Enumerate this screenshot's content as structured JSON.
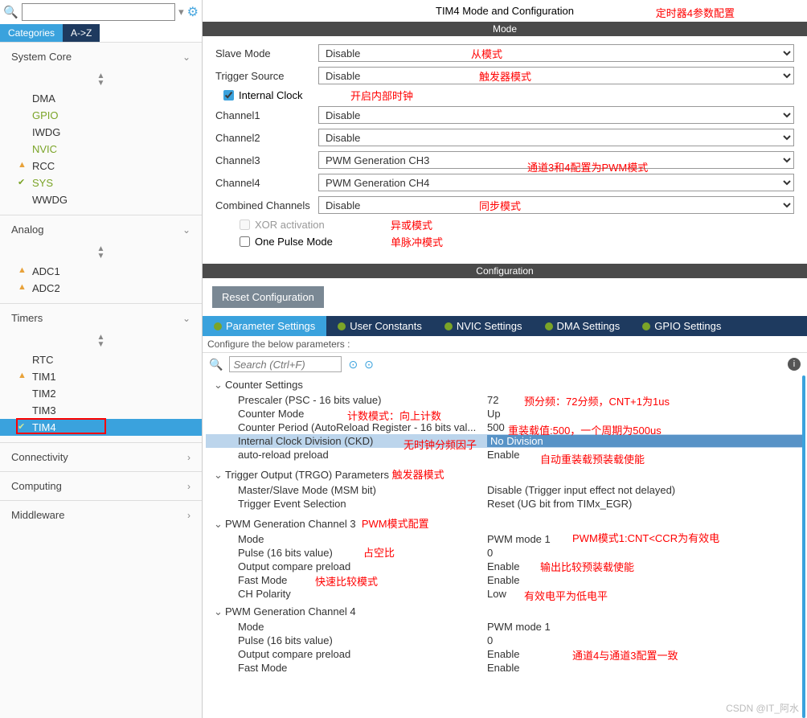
{
  "header": {
    "title": "TIM4 Mode and Configuration",
    "ann_title": "定时器4参数配置"
  },
  "search": {
    "placeholder": ""
  },
  "sb_tabs": {
    "cat": "Categories",
    "az": "A->Z"
  },
  "cats": {
    "system": {
      "label": "System Core",
      "items": [
        "DMA",
        "GPIO",
        "IWDG",
        "NVIC",
        "RCC",
        "SYS",
        "WWDG"
      ]
    },
    "analog": {
      "label": "Analog",
      "items": [
        "ADC1",
        "ADC2"
      ]
    },
    "timers": {
      "label": "Timers",
      "items": [
        "RTC",
        "TIM1",
        "TIM2",
        "TIM3",
        "TIM4"
      ]
    },
    "conn": {
      "label": "Connectivity"
    },
    "comp": {
      "label": "Computing"
    },
    "mw": {
      "label": "Middleware"
    }
  },
  "mode": {
    "hdr": "Mode",
    "slave": {
      "l": "Slave Mode",
      "v": "Disable",
      "a": "从模式"
    },
    "trig": {
      "l": "Trigger Source",
      "v": "Disable",
      "a": "触发器模式"
    },
    "clk": {
      "l": "Internal Clock",
      "a": "开启内部时钟"
    },
    "ch1": {
      "l": "Channel1",
      "v": "Disable"
    },
    "ch2": {
      "l": "Channel2",
      "v": "Disable"
    },
    "ch3": {
      "l": "Channel3",
      "v": "PWM Generation CH3"
    },
    "ch4": {
      "l": "Channel4",
      "v": "PWM Generation CH4"
    },
    "ch_ann": "通道3和4配置为PWM模式",
    "comb": {
      "l": "Combined Channels",
      "v": "Disable",
      "a": "同步模式"
    },
    "xor": {
      "l": "XOR activation",
      "a": "异或模式"
    },
    "pulse": {
      "l": "One Pulse Mode",
      "a": "单脉冲模式"
    }
  },
  "cfg": {
    "hdr": "Configuration",
    "reset": "Reset Configuration",
    "tabs": [
      "Parameter Settings",
      "User Constants",
      "NVIC Settings",
      "DMA Settings",
      "GPIO Settings"
    ],
    "sub": "Configure the below parameters :",
    "search_ph": "Search (Ctrl+F)"
  },
  "params": {
    "g1": {
      "h": "Counter Settings",
      "r1": {
        "l": "Prescaler (PSC - 16 bits value)",
        "v": "72",
        "a": "预分频：72分频，CNT+1为1us"
      },
      "r2": {
        "l": "Counter Mode",
        "v": "Up",
        "a": "计数模式：向上计数"
      },
      "r3": {
        "l": "Counter Period (AutoReload Register - 16 bits val...",
        "v": "500",
        "a": "重装载值:500，一个周期为500us"
      },
      "r4": {
        "l": "Internal Clock Division (CKD)",
        "v": "No Division",
        "a": "无时钟分频因子"
      },
      "r5": {
        "l": "auto-reload preload",
        "v": "Enable",
        "a": "自动重装载预装载使能"
      }
    },
    "g2": {
      "h": "Trigger Output (TRGO) Parameters",
      "a": "触发器模式",
      "r1": {
        "l": "Master/Slave Mode (MSM bit)",
        "v": "Disable (Trigger input effect not delayed)"
      },
      "r2": {
        "l": "Trigger Event Selection",
        "v": "Reset (UG bit from TIMx_EGR)"
      }
    },
    "g3": {
      "h": "PWM Generation Channel 3",
      "a": "PWM模式配置",
      "r1": {
        "l": "Mode",
        "v": "PWM mode 1",
        "a": "PWM模式1:CNT<CCR为有效电"
      },
      "r2": {
        "l": "Pulse (16 bits value)",
        "v": "0",
        "a": "占空比"
      },
      "r3": {
        "l": "Output compare preload",
        "v": "Enable",
        "a": "输出比较预装载使能"
      },
      "r4": {
        "l": "Fast Mode",
        "v": "Enable",
        "a": "快速比较模式"
      },
      "r5": {
        "l": "CH Polarity",
        "v": "Low",
        "a": "有效电平为低电平"
      }
    },
    "g4": {
      "h": "PWM Generation Channel 4",
      "r1": {
        "l": "Mode",
        "v": "PWM mode 1"
      },
      "r2": {
        "l": "Pulse (16 bits value)",
        "v": "0"
      },
      "r3": {
        "l": "Output compare preload",
        "v": "Enable",
        "a": "通道4与通道3配置一致"
      },
      "r4": {
        "l": "Fast Mode",
        "v": "Enable"
      }
    }
  },
  "watermark": "CSDN @IT_阿水"
}
